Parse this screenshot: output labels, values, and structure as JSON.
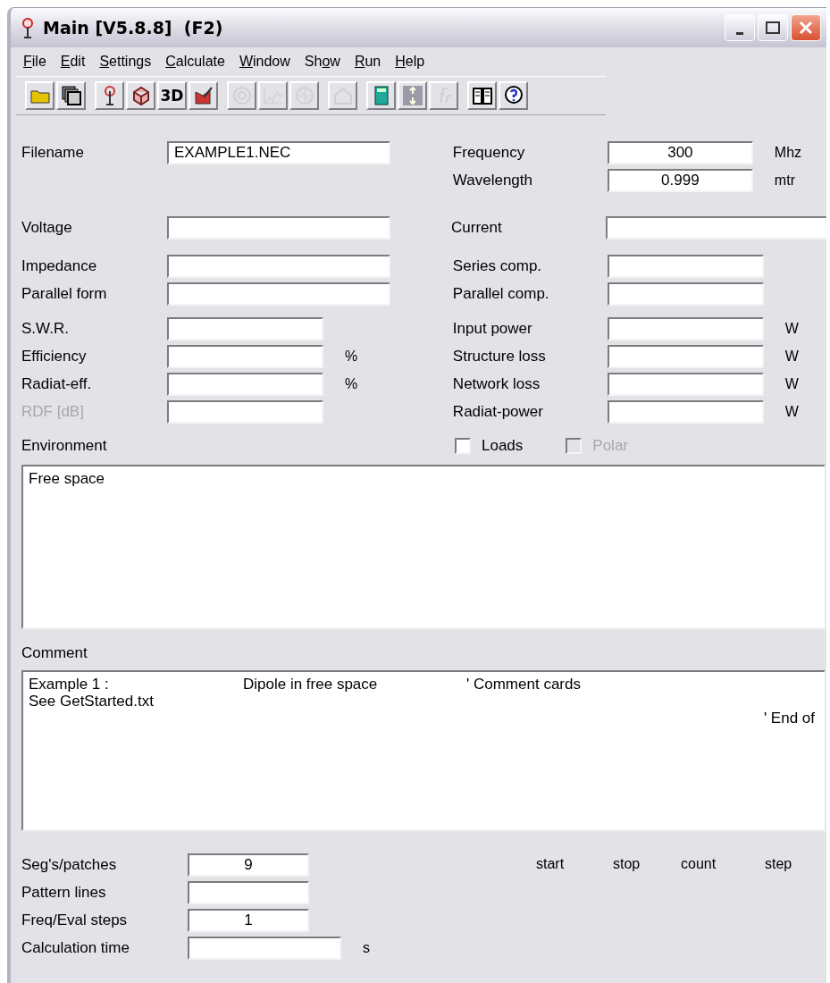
{
  "window": {
    "title": "Main [V5.8.8]  (F2)"
  },
  "menu": [
    {
      "key": "F",
      "after": "ile"
    },
    {
      "key": "E",
      "after": "dit"
    },
    {
      "key": "S",
      "after": "ettings"
    },
    {
      "key": "C",
      "after": "alculate"
    },
    {
      "key": "W",
      "after": "indow"
    },
    {
      "before": "Sh",
      "key": "o",
      "after": "w"
    },
    {
      "key": "R",
      "after": "un"
    },
    {
      "key": "H",
      "after": "elp"
    }
  ],
  "toolbar": [
    [
      {
        "kind": "folder",
        "disabled": false
      },
      {
        "kind": "windows",
        "disabled": false
      }
    ],
    [
      {
        "kind": "antenna",
        "disabled": false
      },
      {
        "kind": "cube",
        "disabled": false
      },
      {
        "kind": "text",
        "label": "3D",
        "disabled": false
      },
      {
        "kind": "pencil",
        "disabled": false
      }
    ],
    [
      {
        "kind": "circle",
        "disabled": true
      },
      {
        "kind": "chart",
        "disabled": true
      },
      {
        "kind": "globe",
        "disabled": true
      }
    ],
    [
      {
        "kind": "house",
        "disabled": true
      }
    ],
    [
      {
        "kind": "calculator",
        "disabled": false
      },
      {
        "kind": "arrows",
        "disabled": false
      },
      {
        "kind": "script",
        "disabled": true
      }
    ],
    [
      {
        "kind": "book",
        "disabled": false
      },
      {
        "kind": "help",
        "disabled": false
      }
    ]
  ],
  "groups": [
    {
      "rows": [
        {
          "left": {
            "label": "Filename",
            "value": "EXAMPLE1.NEC"
          },
          "right": {
            "label": "Frequency",
            "value": "300",
            "unit": "Mhz"
          }
        },
        {
          "right": {
            "label": "Wavelength",
            "value": "0.999",
            "unit": "mtr"
          }
        }
      ]
    },
    {
      "rows": [
        {
          "left": {
            "label": "Voltage"
          },
          "right": {
            "label": "Current"
          }
        }
      ]
    },
    {
      "rows": [
        {
          "left": {
            "label": "Impedance"
          },
          "right": {
            "label": "Series comp."
          }
        },
        {
          "left": {
            "label": "Parallel form"
          },
          "right": {
            "label": "Parallel comp."
          }
        }
      ]
    },
    {
      "rows": [
        {
          "left": {
            "label": "S.W.R."
          },
          "right": {
            "label": "Input power",
            "unit": "W"
          }
        },
        {
          "left": {
            "label": "Efficiency",
            "unit": "%"
          },
          "right": {
            "label": "Structure loss",
            "unit": "W"
          }
        },
        {
          "left": {
            "label": "Radiat-eff.",
            "unit": "%"
          },
          "right": {
            "label": "Network loss",
            "unit": "W"
          }
        },
        {
          "left": {
            "label": "RDF [dB]",
            "disabled": true
          },
          "right": {
            "label": "Radiat-power",
            "unit": "W"
          }
        }
      ]
    }
  ],
  "environment": {
    "label": "Environment",
    "text": "Free space"
  },
  "checkboxes": [
    {
      "label": "Loads",
      "checked": false,
      "disabled": false
    },
    {
      "label": "Polar",
      "checked": false,
      "disabled": true
    }
  ],
  "comment": {
    "label": "Comment",
    "lines": [
      {
        "kind": "columns",
        "parts": [
          "Example 1 :",
          "Dipole in free space",
          "' Comment cards"
        ]
      },
      {
        "kind": "columns",
        "parts": [
          "See GetStarted.txt"
        ]
      },
      {
        "kind": "right",
        "parts": [
          "' End of"
        ]
      }
    ]
  },
  "calc": {
    "rows": [
      {
        "label": "Seg's/patches",
        "value": "9"
      },
      {
        "label": "Pattern lines"
      },
      {
        "label": "Freq/Eval steps",
        "value": "1"
      },
      {
        "label": "Calculation time",
        "unit": "s"
      }
    ],
    "headings": [
      "start",
      "stop",
      "count",
      "step"
    ]
  }
}
